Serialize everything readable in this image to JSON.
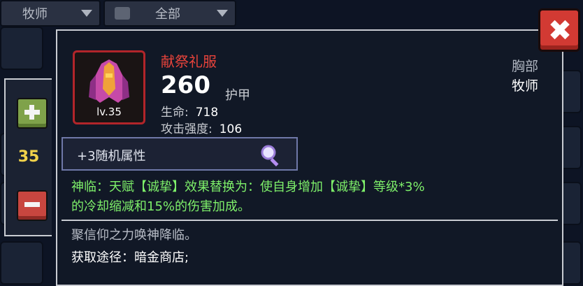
{
  "filters": {
    "class_filter": "牧师",
    "category_filter": "全部"
  },
  "quantity": {
    "value": "35"
  },
  "item": {
    "name": "献祭礼服",
    "level": "lv.35",
    "armor_value": "260",
    "armor_label": "护甲",
    "stats": [
      {
        "label": "生命:",
        "value": "718"
      },
      {
        "label": "攻击强度:",
        "value": "106"
      }
    ],
    "slot": "胸部",
    "class": "牧师",
    "random_attr": "+3随机属性",
    "effect_line1": "神临：天赋【诚挚】效果替换为：使自身增加【诚挚】等级*3%",
    "effect_line2": "的冷却缩减和15%的伤害加成。",
    "lore": "聚信仰之力唤神降临。",
    "source": "获取途径：暗金商店;"
  },
  "colors": {
    "item_name": "#e8433b",
    "effect": "#7ef06a",
    "quantity": "#f2d24a",
    "frame_rarity": "#b2252a",
    "close_button": "#d23a33"
  },
  "icons": {
    "close": "close-icon",
    "plus": "plus-icon",
    "minus": "minus-icon",
    "magnifier": "magnifier-icon",
    "item": "robe-icon"
  }
}
